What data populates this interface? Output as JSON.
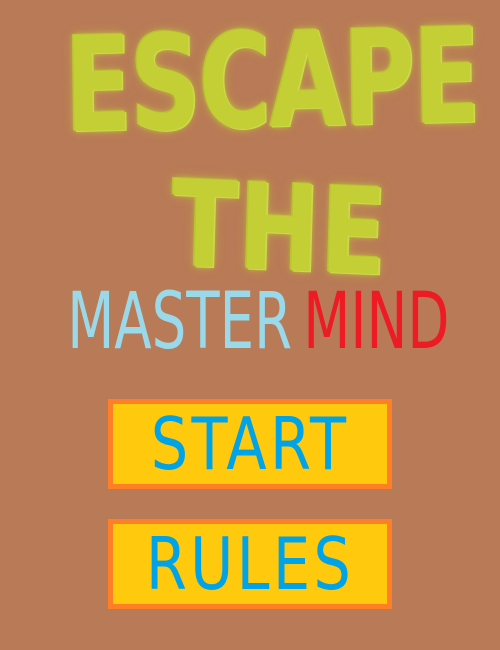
{
  "game": {
    "title_line_1": "ESCAPE",
    "title_line_2": "THE",
    "subtitle_part_1": "MASTER",
    "subtitle_part_2": "MIND"
  },
  "menu": {
    "start_label": "START",
    "rules_label": "RULES"
  },
  "colors": {
    "background": "#b97a57",
    "title": "#c4cf36",
    "subtitle_master": "#99d9ea",
    "subtitle_mind": "#ed1c24",
    "button_fill": "#ffc90e",
    "button_border": "#ff7f27",
    "button_text": "#00a2e8"
  }
}
